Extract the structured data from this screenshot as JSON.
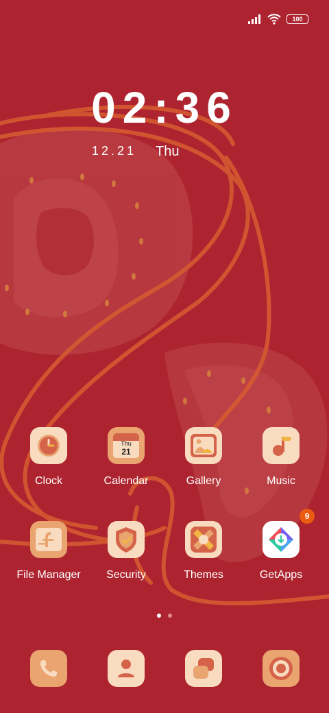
{
  "status_bar": {
    "battery": "100",
    "icons": [
      "signal-icon",
      "wifi-icon",
      "battery-icon"
    ]
  },
  "lock_clock": {
    "time": "02:36",
    "date": "12.21",
    "weekday": "Thu"
  },
  "apps_row1": [
    {
      "label": "Clock",
      "icon": "clock-icon"
    },
    {
      "label": "Calendar",
      "icon": "calendar-icon",
      "calendar_day": "Thu",
      "calendar_date": "21"
    },
    {
      "label": "Gallery",
      "icon": "gallery-icon"
    },
    {
      "label": "Music",
      "icon": "music-icon"
    }
  ],
  "apps_row2": [
    {
      "label": "File Manager",
      "icon": "file-manager-icon"
    },
    {
      "label": "Security",
      "icon": "security-icon"
    },
    {
      "label": "Themes",
      "icon": "themes-icon"
    },
    {
      "label": "GetApps",
      "icon": "getapps-icon",
      "badge": "9"
    }
  ],
  "dock": [
    {
      "icon": "phone-icon"
    },
    {
      "icon": "contacts-icon"
    },
    {
      "icon": "messages-icon"
    },
    {
      "icon": "camera-icon"
    }
  ],
  "page_indicator": {
    "pages": 2,
    "active": 1
  },
  "colors": {
    "background": "#ad2430",
    "icon_bg": "#f9dcc0",
    "icon_bg_alt": "#e9a46f",
    "accent": "#c8534a",
    "badge": "#ea5a10"
  }
}
